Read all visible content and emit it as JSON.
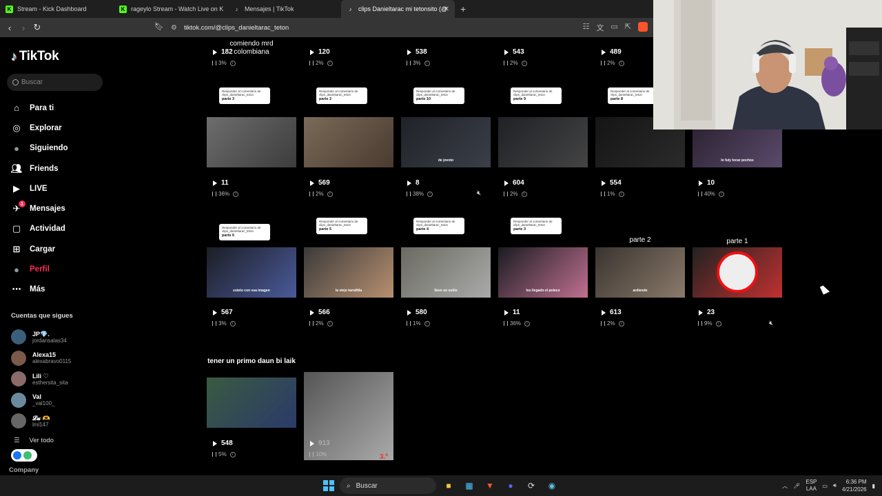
{
  "browser": {
    "tabs": [
      {
        "label": "Stream - Kick Dashboard",
        "active": false,
        "favicon": "kick-icon"
      },
      {
        "label": "rageylo Stream - Watch Live on K",
        "active": false,
        "favicon": "kick-icon"
      },
      {
        "label": "Mensajes | TikTok",
        "active": false,
        "favicon": "tiktok-icon"
      },
      {
        "label": "clips Danieltarac mi tetonsito (@",
        "active": true,
        "favicon": "tiktok-icon"
      }
    ],
    "url": "tiktok.com/@clips_danieltarac_teton"
  },
  "sidebar": {
    "brand": "TikTok",
    "search_placeholder": "Buscar",
    "nav": [
      {
        "label": "Para ti",
        "icon": "home-icon"
      },
      {
        "label": "Explorar",
        "icon": "compass-icon"
      },
      {
        "label": "Siguiendo",
        "icon": "following-avatar-icon"
      },
      {
        "label": "Friends",
        "icon": "friends-icon"
      },
      {
        "label": "LIVE",
        "icon": "live-icon"
      },
      {
        "label": "Mensajes",
        "icon": "messages-icon",
        "badge": "1"
      },
      {
        "label": "Actividad",
        "icon": "activity-icon"
      },
      {
        "label": "Cargar",
        "icon": "upload-icon"
      },
      {
        "label": "Perfil",
        "icon": "profile-avatar-icon",
        "active": true
      },
      {
        "label": "Más",
        "icon": "more-icon"
      }
    ],
    "following_title": "Cuentas que sigues",
    "following": [
      {
        "name": "JP💎.",
        "handle": "jordansalas34"
      },
      {
        "name": "Alexa15",
        "handle": "alexabravo0115"
      },
      {
        "name": "Lili ♡",
        "handle": "esthersita_sita"
      },
      {
        "name": "Val",
        "handle": "_val100_"
      },
      {
        "name": "𝓛𝓾 🫶",
        "handle": "lml147"
      }
    ],
    "see_all": "Ver todo",
    "company": "Company"
  },
  "videos": [
    {
      "views": "182",
      "pct": "3%",
      "caption": "comiendo mrd colombiana"
    },
    {
      "views": "120",
      "pct": "2%"
    },
    {
      "views": "538",
      "pct": "3%"
    },
    {
      "views": "543",
      "pct": "2%"
    },
    {
      "views": "489",
      "pct": "2%"
    },
    {
      "views": "",
      "pct": ""
    },
    {
      "views": "11",
      "pct": "36%",
      "reply": "Responder al comentario de clips_danieltarac_teton",
      "part": "parte 3"
    },
    {
      "views": "569",
      "pct": "2%",
      "reply": "Responder al comentario de clips_danieltarac_teton",
      "part": "parte 2"
    },
    {
      "views": "8",
      "pct": "38%",
      "reply": "Responder al comentario de clips_danieltarac_teton",
      "part": "parte 10",
      "overlay": "de jovoto"
    },
    {
      "views": "604",
      "pct": "2%",
      "reply": "Responder al comentario de clips_danieltarac_teton",
      "part": "parte 9"
    },
    {
      "views": "554",
      "pct": "1%",
      "reply": "Responder al comentario de clips_danieltarac_teton",
      "part": "parte 8"
    },
    {
      "views": "10",
      "pct": "40%",
      "overlay": "lo fuiy tocar pochos"
    },
    {
      "views": "567",
      "pct": "3%",
      "reply": "Responder al comentario de clips_danieltarac_teton",
      "part": "parte 6",
      "overlay": "ssteto con esa imagen"
    },
    {
      "views": "566",
      "pct": "2%",
      "reply": "Responder al comentario de clips_danieltarac_teton",
      "part": "parte 5",
      "overlay": "la viejo tarrafitla"
    },
    {
      "views": "580",
      "pct": "1%",
      "reply": "Responder al comentario de clips_danieltarac_teton",
      "part": "parte 4",
      "overlay": "llevo un estilo"
    },
    {
      "views": "11",
      "pct": "36%",
      "reply": "Responder al comentario de clips_danieltarac_teton",
      "part": "parte 3",
      "overlay": "los llegado el poleco"
    },
    {
      "views": "613",
      "pct": "2%",
      "caption": "parte 2",
      "overlay": "ardiendo"
    },
    {
      "views": "23",
      "pct": "9%",
      "caption": "parte 1"
    },
    {
      "views": "548",
      "pct": "5%",
      "caption": "tener un primo daun bi laik"
    },
    {
      "views": "913",
      "pct": "10%",
      "overlay": "3.º"
    }
  ],
  "taskbar": {
    "search": "Buscar",
    "lang_top": "ESP",
    "lang_bottom": "LAA",
    "time": "6:36 PM",
    "date": "4/21/2026"
  },
  "colors": {
    "accent": "#fe2c55",
    "tiktok_cyan": "#25f4ee"
  }
}
